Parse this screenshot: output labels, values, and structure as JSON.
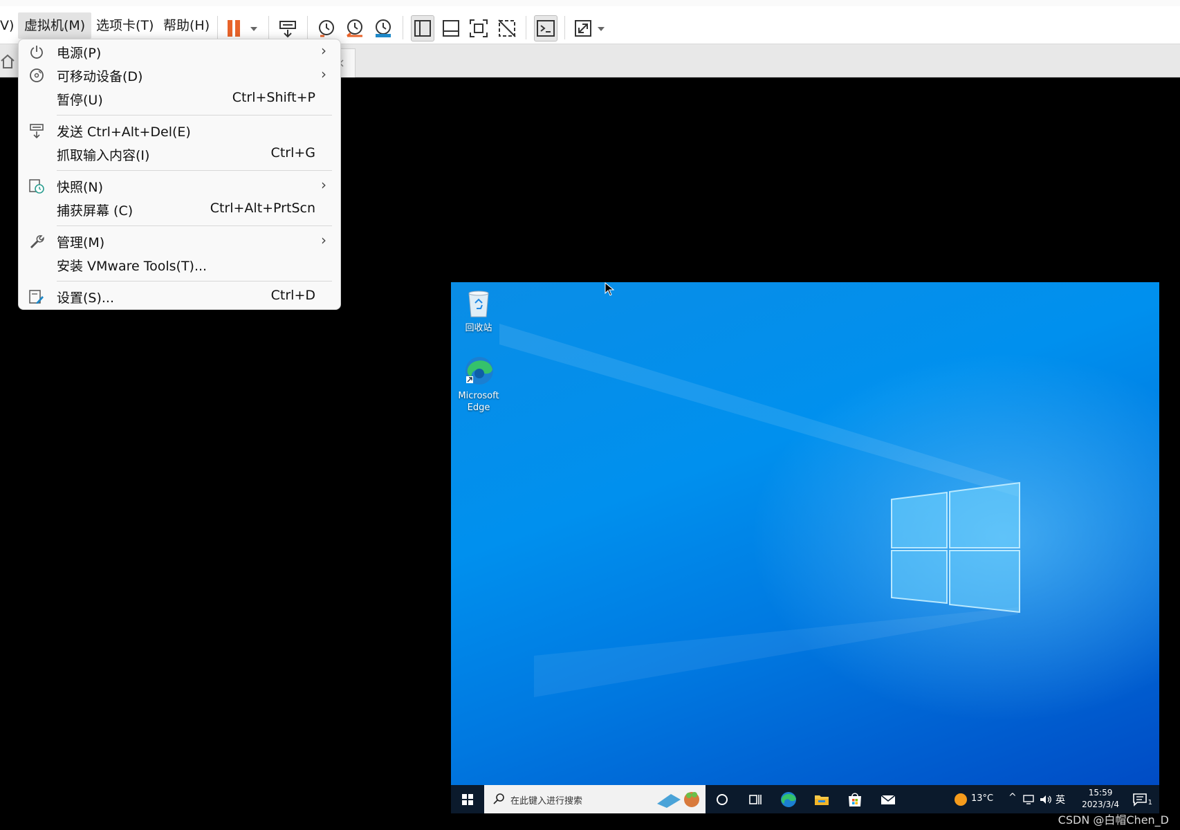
{
  "menubar": {
    "items": [
      {
        "label": "V)"
      },
      {
        "label": "虚拟机(M)"
      },
      {
        "label": "选项卡(T)"
      },
      {
        "label": "帮助(H)"
      }
    ]
  },
  "vm_menu": {
    "items": [
      {
        "label": "电源(P)",
        "shortcut": ""
      },
      {
        "label": "可移动设备(D)",
        "shortcut": ""
      },
      {
        "label": "暂停(U)",
        "shortcut": "Ctrl+Shift+P"
      },
      {
        "label": "发送 Ctrl+Alt+Del(E)",
        "shortcut": ""
      },
      {
        "label": "抓取输入内容(I)",
        "shortcut": "Ctrl+G"
      },
      {
        "label": "快照(N)",
        "shortcut": ""
      },
      {
        "label": "捕获屏幕 (C)",
        "shortcut": "Ctrl+Alt+PrtScn"
      },
      {
        "label": "管理(M)",
        "shortcut": ""
      },
      {
        "label": "安装 VMware Tools(T)...",
        "shortcut": ""
      },
      {
        "label": "设置(S)...",
        "shortcut": "Ctrl+D"
      }
    ]
  },
  "tab": {
    "close": "×"
  },
  "desktop": {
    "icons": [
      {
        "label": "回收站"
      },
      {
        "label": "Microsoft Edge"
      }
    ]
  },
  "taskbar": {
    "search_placeholder": "在此键入进行搜索",
    "weather": "13°C",
    "ime": "英",
    "time": "15:59",
    "date": "2023/3/4",
    "notification_count": "1"
  },
  "watermark": "CSDN @白帽Chen_D",
  "colors": {
    "pause_orange": "#e8632a",
    "desktop_blue": "#0090ee",
    "taskbar": "#0b1a2c"
  }
}
